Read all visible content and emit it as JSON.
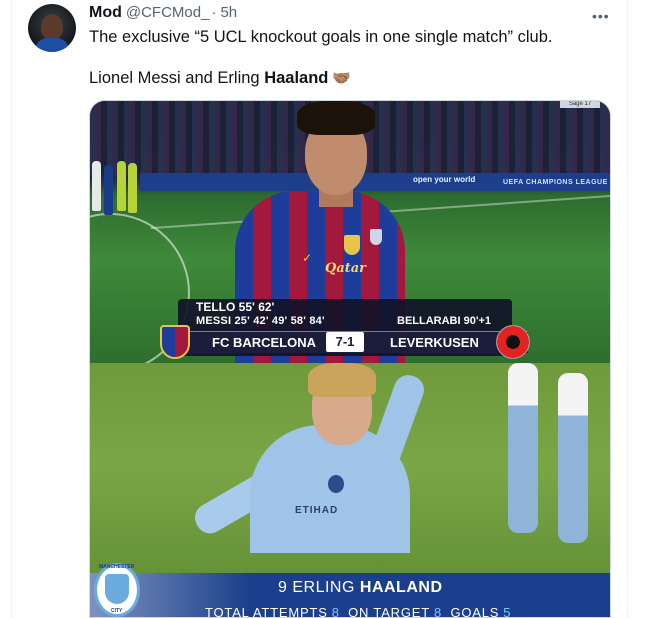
{
  "tweet": {
    "display_name": "Mod",
    "handle": "@CFCMod_",
    "separator": "·",
    "time": "5h",
    "text_line1": "The exclusive “5 UCL knockout goals in one single match” club.",
    "text_line2_prefix": "Lionel Messi and Erling ",
    "text_line2_bold": "Haaland",
    "emoji": "🤝🏽",
    "more_label": "•••"
  },
  "image1": {
    "corner_tag": "Sage 17",
    "board_right_1": "open your world",
    "board_right_2": "UEFA CHAMPIONS LEAGUE",
    "shirt_sponsor": "Qatar",
    "score_graphic": {
      "home_scorers_1": "TELLO 55' 62'",
      "home_scorers_2": "MESSI 25' 42' 49' 58' 84'",
      "away_scorers": "BELLARABI 90'+1",
      "home_team": "FC BARCELONA",
      "score": "7-1",
      "away_team": "LEVERKUSEN"
    }
  },
  "image2": {
    "shirt_sponsor": "ETIHAD",
    "crest_top": "MANCHESTER",
    "crest_bottom": "CITY",
    "player_number": "9",
    "player_first": "ERLING",
    "player_last": "HAALAND",
    "stats_label_1": "TOTAL ATTEMPTS",
    "stats_value_1": "8",
    "stats_label_2": "ON TARGET",
    "stats_value_2": "8",
    "stats_label_3": "GOALS",
    "stats_value_3": "5"
  },
  "colors": {
    "link_gray": "#536471",
    "text": "#0f1419",
    "stat_bar": "#1b3f8c",
    "stat_value": "#7fc2ff"
  }
}
